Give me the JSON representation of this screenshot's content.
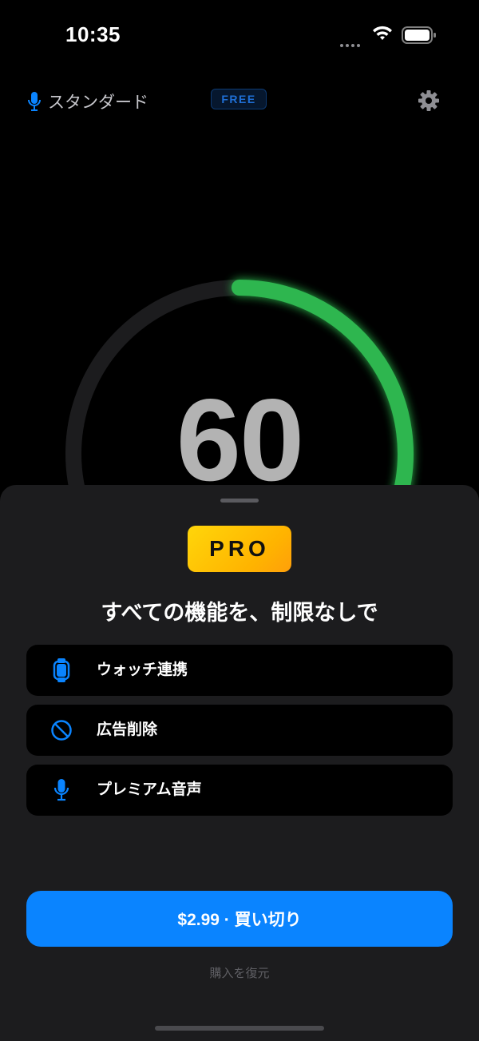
{
  "status_bar": {
    "time": "10:35"
  },
  "header": {
    "mode_label": "スタンダード",
    "plan_badge": "FREE"
  },
  "counter": {
    "value": "60",
    "progress_fraction": 0.3,
    "ring_color": "#30d158"
  },
  "paywall": {
    "badge": "PRO",
    "headline": "すべての機能を、制限なしで",
    "features": [
      {
        "icon": "watch-icon",
        "label": "ウォッチ連携"
      },
      {
        "icon": "no-ads-icon",
        "label": "広告削除"
      },
      {
        "icon": "microphone-icon",
        "label": "プレミアム音声"
      }
    ],
    "buy_label": "$2.99 · 買い切り",
    "restore_label": "購入を復元"
  },
  "colors": {
    "accent": "#0a84ff",
    "pro_gold": "#ffc107",
    "sheet_background": "#1c1c1e"
  }
}
